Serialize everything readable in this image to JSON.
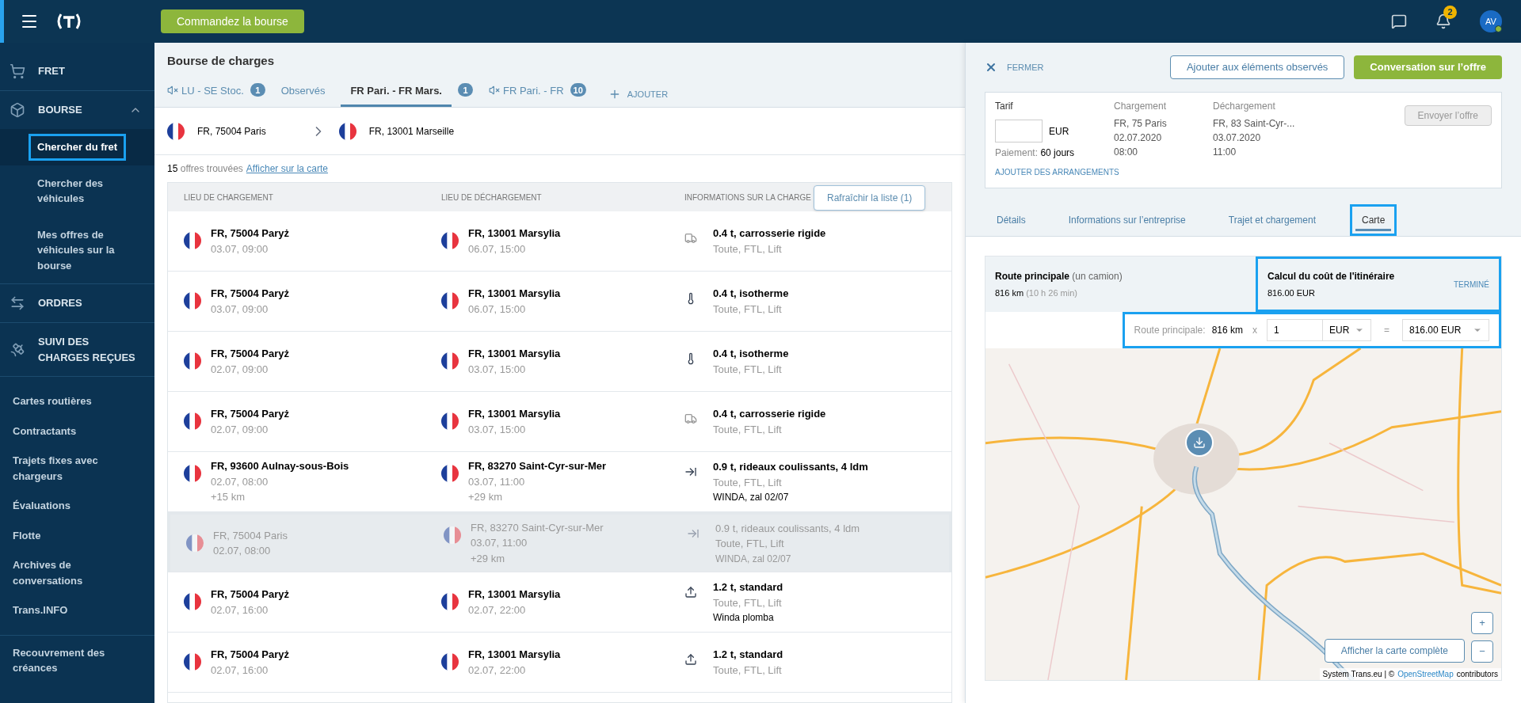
{
  "topbar": {
    "order_button": "Commandez la bourse",
    "notification_count": "2",
    "avatar": "AV"
  },
  "sidebar": {
    "sections": [
      {
        "kind": "cart",
        "label": "FRET",
        "expanded": false
      },
      {
        "kind": "box",
        "label": "BOURSE",
        "expanded": true,
        "children": [
          {
            "label": "Chercher du fret",
            "selected": true,
            "highlighted": true
          },
          {
            "label": "Chercher des véhicules",
            "selected": false,
            "highlighted": false
          },
          {
            "label": "Mes offres de véhicules sur la bourse",
            "selected": false,
            "highlighted": false
          }
        ]
      },
      {
        "kind": "arrows",
        "label": "ORDRES",
        "expanded": false
      },
      {
        "kind": "satellite",
        "label": "SUIVI DES CHARGES REÇUES",
        "expanded": false
      }
    ],
    "links": [
      "Cartes routières",
      "Contractants",
      "Trajets fixes avec chargeurs",
      "Évaluations",
      "Flotte",
      "Archives de conversations",
      "Trans.INFO"
    ],
    "footer_link": "Recouvrement des créances"
  },
  "main": {
    "title": "Bourse de charges",
    "tabs": [
      {
        "label": "LU - SE Stoc.",
        "muted": true,
        "badge": "1",
        "selected": false
      },
      {
        "label": "Observés",
        "muted": false,
        "selected": false
      },
      {
        "label": "FR Pari. - FR Mars.",
        "muted": false,
        "badge": "1",
        "selected": true
      },
      {
        "label": "FR Pari. - FR",
        "muted": true,
        "badge": "10",
        "selected": false
      }
    ],
    "add_button": "AJOUTER",
    "route": {
      "from": "FR, 75004 Paris",
      "to": "FR, 13001 Marseille"
    },
    "results": {
      "count": "15",
      "text": "offres trouvées",
      "map_link": "Afficher sur la carte"
    },
    "refresh_button": "Rafraîchir la liste (1)",
    "table": {
      "columns": [
        "LIEU DE CHARGEMENT",
        "LIEU DE DÉCHARGEMENT",
        "INFORMATIONS SUR LA CHARGE"
      ],
      "rows": [
        {
          "selected": false,
          "highlighted": false,
          "loading": {
            "place": "FR, 75004 Paryż",
            "date": "03.07, 09:00"
          },
          "unloading": {
            "place": "FR, 13001 Marsylia",
            "date": "06.07, 15:00"
          },
          "cargo": {
            "kind": "truck",
            "title": "0.4 t, carrosserie rigide",
            "details": "Toute, FTL, Lift"
          }
        },
        {
          "selected": false,
          "highlighted": false,
          "loading": {
            "place": "FR, 75004 Paryż",
            "date": "03.07, 09:00"
          },
          "unloading": {
            "place": "FR, 13001 Marsylia",
            "date": "06.07, 15:00"
          },
          "cargo": {
            "kind": "isotherm",
            "title": "0.4 t, isotherme",
            "details": "Toute, FTL, Lift"
          }
        },
        {
          "selected": false,
          "highlighted": false,
          "loading": {
            "place": "FR, 75004 Paryż",
            "date": "02.07, 09:00"
          },
          "unloading": {
            "place": "FR, 13001 Marsylia",
            "date": "03.07, 15:00"
          },
          "cargo": {
            "kind": "isotherm",
            "title": "0.4 t, isotherme",
            "details": "Toute, FTL, Lift"
          }
        },
        {
          "selected": false,
          "highlighted": false,
          "loading": {
            "place": "FR, 75004 Paryż",
            "date": "02.07, 09:00"
          },
          "unloading": {
            "place": "FR, 13001 Marsylia",
            "date": "03.07, 15:00"
          },
          "cargo": {
            "kind": "truck",
            "title": "0.4 t, carrosserie rigide",
            "details": "Toute, FTL, Lift"
          }
        },
        {
          "selected": false,
          "highlighted": false,
          "loading": {
            "place": "FR, 93600 Aulnay-sous-Bois",
            "date": "02.07, 08:00",
            "extra": "+15 km"
          },
          "unloading": {
            "place": "FR, 83270 Saint-Cyr-sur-Mer",
            "date": "03.07, 11:00",
            "extra": "+29 km"
          },
          "cargo": {
            "kind": "curtain",
            "title": "0.9 t, rideaux coulissants, 4 ldm",
            "details": "Toute, FTL, Lift",
            "note": "WINDA, zal 02/07"
          }
        },
        {
          "selected": true,
          "highlighted": true,
          "loading": {
            "place": "FR, 75004 Paris",
            "date": "02.07, 08:00"
          },
          "unloading": {
            "place": "FR, 83270 Saint-Cyr-sur-Mer",
            "date": "03.07, 11:00",
            "extra": "+29 km"
          },
          "cargo": {
            "kind": "curtain",
            "title": "0.9 t, rideaux coulissants, 4 ldm",
            "details": "Toute, FTL, Lift",
            "note": "WINDA, zal 02/07"
          }
        },
        {
          "selected": false,
          "highlighted": false,
          "loading": {
            "place": "FR, 75004 Paryż",
            "date": "02.07, 16:00"
          },
          "unloading": {
            "place": "FR, 13001 Marsylia",
            "date": "02.07, 22:00"
          },
          "cargo": {
            "kind": "standard",
            "title": "1.2 t, standard",
            "details": "Toute, FTL, Lift",
            "note": "Winda plomba"
          }
        },
        {
          "selected": false,
          "highlighted": false,
          "loading": {
            "place": "FR, 75004 Paryż",
            "date": "02.07, 16:00"
          },
          "unloading": {
            "place": "FR, 13001 Marsylia",
            "date": "02.07, 22:00"
          },
          "cargo": {
            "kind": "standard",
            "title": "1.2 t, standard",
            "details": "Toute, FTL, Lift"
          }
        }
      ]
    }
  },
  "panel": {
    "close": "FERMER",
    "watch_button": "Ajouter aux éléments observés",
    "chat_button": "Conversation sur l’offre",
    "offer": {
      "tarif_label": "Tarif",
      "currency": "EUR",
      "payment_label": "Paiement:",
      "payment_value": "60 jours",
      "loading": {
        "label": "Chargement",
        "lines": [
          "FR, 75 Paris",
          "02.07.2020",
          "08:00"
        ]
      },
      "unloading": {
        "label": "Déchargement",
        "lines": [
          "FR, 83 Saint-Cyr-...",
          "03.07.2020",
          "11:00"
        ]
      },
      "send_button": {
        "label": "Envoyer l’offre",
        "disabled": true
      },
      "arrangements_link": "AJOUTER DES ARRANGEMENTS"
    },
    "tabs": [
      {
        "label": "Détails",
        "selected": false,
        "highlighted": false
      },
      {
        "label": "Informations sur l’entreprise",
        "selected": false,
        "highlighted": false
      },
      {
        "label": "Trajet et chargement",
        "selected": false,
        "highlighted": false
      },
      {
        "label": "Carte",
        "selected": true,
        "highlighted": true
      }
    ],
    "route": {
      "title": "Route principale",
      "subtitle": "(un camion)",
      "distance": "816 km",
      "duration": "(10 h 26 min)"
    },
    "cost": {
      "title": "Calcul du coût de l'itinéraire",
      "amount": "816.00 EUR",
      "status": "TERMINÉ",
      "highlighted": true
    },
    "calc": {
      "label": "Route principale:",
      "distance": "816 km",
      "multiply": "x",
      "rate": "1",
      "currency": "EUR",
      "equals": "=",
      "total": "816.00 EUR",
      "highlighted": true
    },
    "map": {
      "full_map_button": "Afficher la carte complète",
      "zoom_in": "+",
      "zoom_out": "−",
      "attribution": "System Trans.eu | ©",
      "attribution_link": "OpenStreetMap",
      "attribution_end": "contributors"
    }
  }
}
